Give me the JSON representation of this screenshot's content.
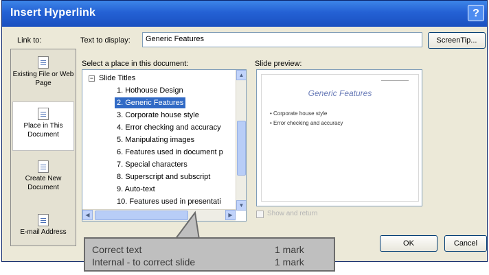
{
  "window": {
    "title": "Insert Hyperlink",
    "help": "?"
  },
  "link_to": {
    "label": "Link to:",
    "items": [
      {
        "label": "Existing File or Web Page",
        "icon": "web-page-icon"
      },
      {
        "label": "Place in This Document",
        "icon": "place-in-document-icon",
        "selected": true
      },
      {
        "label": "Create New Document",
        "icon": "new-document-icon"
      },
      {
        "label": "E-mail Address",
        "icon": "email-icon"
      }
    ]
  },
  "text_to_display": {
    "label": "Text to display:",
    "value": "Generic Features"
  },
  "screentip_button": "ScreenTip...",
  "place_list": {
    "label": "Select a place in this document:",
    "root": "Slide Titles",
    "items": [
      "1. Hothouse Design",
      "2. Generic Features",
      "3. Corporate house style",
      "4. Error checking and accuracy",
      "5. Manipulating images",
      "6. Features used in document p",
      "7. Special characters",
      "8. Superscript and subscript",
      "9. Auto-text",
      "10. Features used in presentati"
    ],
    "selected_index": 1
  },
  "slide_preview": {
    "label": "Slide preview:",
    "slide_title": "Generic Features",
    "bullets": [
      "Corporate house style",
      "Error checking and accuracy"
    ]
  },
  "show_and_return": {
    "label": "Show and return",
    "checked": false
  },
  "ok_button": "OK",
  "cancel_button": "Cancel",
  "callout": {
    "rows": [
      {
        "criterion": "Correct text",
        "marks": "1 mark"
      },
      {
        "criterion": "Internal - to correct slide",
        "marks": "1 mark"
      }
    ]
  },
  "colors": {
    "titlebar": "#2461d4",
    "selection": "#316ac5",
    "dialog_bg": "#ece9d8",
    "callout_bg": "#bfbfbf"
  }
}
